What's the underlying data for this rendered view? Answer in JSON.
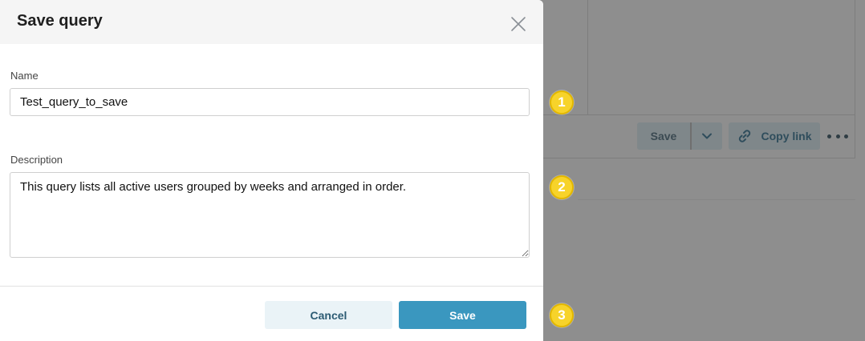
{
  "modal": {
    "title": "Save query",
    "name_label": "Name",
    "name_value": "Test_query_to_save",
    "description_label": "Description",
    "description_value": "This query lists all active users grouped by weeks and arranged in order.",
    "cancel_label": "Cancel",
    "save_label": "Save"
  },
  "background": {
    "toolbar": {
      "save_label": "Save",
      "copy_link_label": "Copy link"
    },
    "callouts": [
      "1",
      "2",
      "3"
    ]
  },
  "colors": {
    "primary": "#3a97bf",
    "callout": "#f7d32a"
  }
}
